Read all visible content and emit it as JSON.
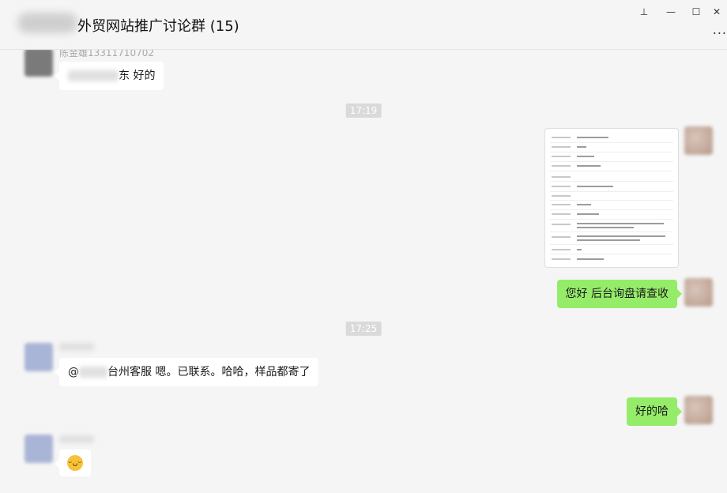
{
  "window": {
    "title": "外贸网站推广讨论群 (15)",
    "controls": {
      "pin": "⊥",
      "minimize": "—",
      "maximize": "☐",
      "close": "✕",
      "more": "..."
    }
  },
  "messages": {
    "m1": {
      "sender": "陈金雄13311710702",
      "text_tail": "东 好的"
    },
    "t1": "17:19",
    "m3": {
      "text": "您好 后台询盘请查收"
    },
    "t2": "17:25",
    "m4": {
      "prefix": "@",
      "text": "台州客服 嗯。已联系。哈哈，样品都寄了"
    },
    "m5": {
      "text": "好的哈"
    },
    "m6": {
      "emoji": "grin-emoji"
    }
  },
  "colors": {
    "outgoing_bubble": "#95ec69",
    "incoming_bubble": "#ffffff",
    "background": "#f5f5f5"
  }
}
